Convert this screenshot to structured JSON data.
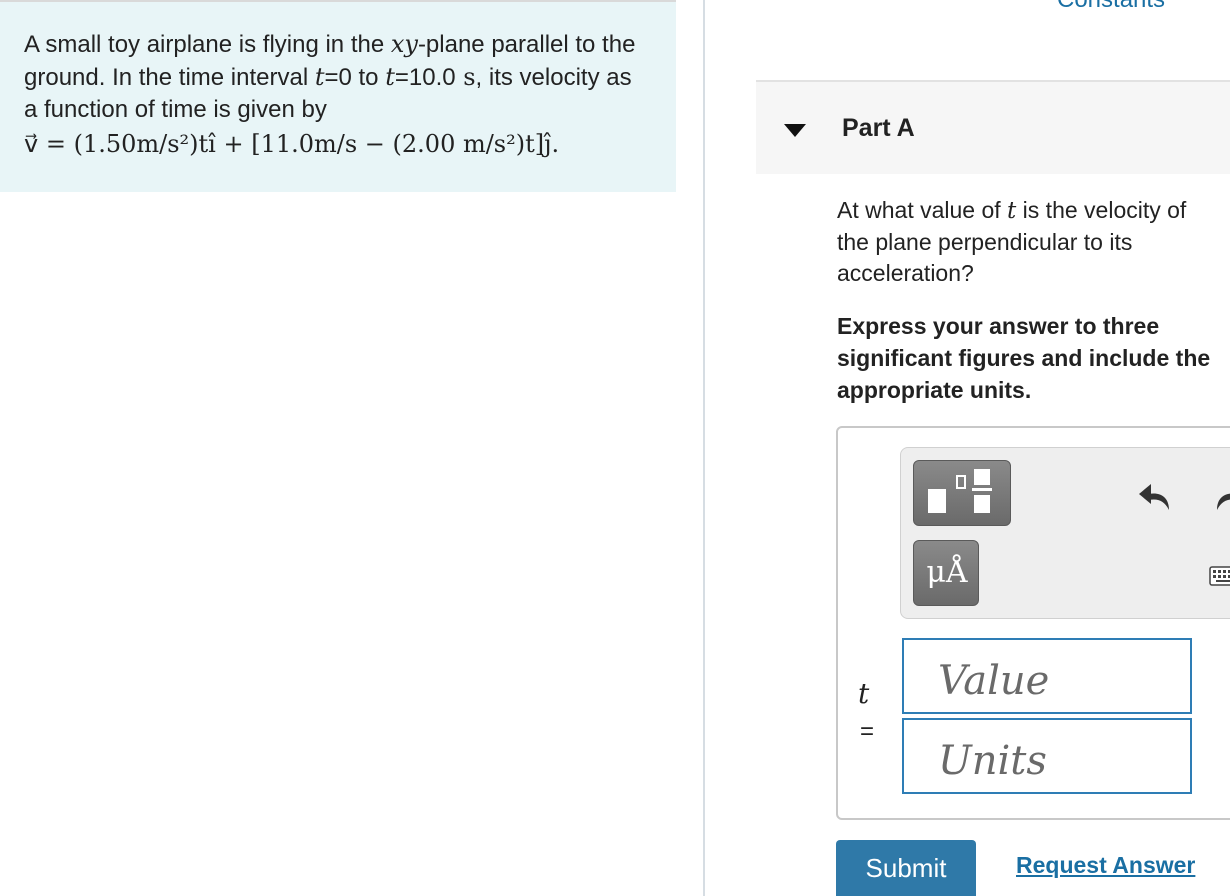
{
  "problem": {
    "text_1": "A small toy airplane is flying in the ",
    "var_xy": "xy",
    "text_2": "-plane parallel to the ground. In the time interval ",
    "var_t": "t",
    "text_3": "=0 to ",
    "text_4": "=10.0",
    "unit_s": " s",
    "text_5": ", its velocity as a function of time is given by",
    "equation": "v⃗ = (1.50m/s²)tî + [11.0m/s − (2.00 m/s²)t]ĵ."
  },
  "constants_link": "Constants",
  "part": {
    "title": "Part A",
    "question_1": "At what value of ",
    "question_var": "t",
    "question_2": " is the velocity of",
    "question_3": "the plane perpendicular to its",
    "question_4": "acceleration?",
    "instructions": "Express your answer to three significant figures and include the appropriate units."
  },
  "toolbar": {
    "units_button_label": "μÅ",
    "templates_icon": "templates-icon",
    "undo_icon": "undo-icon",
    "redo_icon": "redo-icon",
    "keyboard_icon": "keyboard-icon"
  },
  "answer": {
    "variable": "t",
    "equals": "=",
    "value_placeholder": "Value",
    "units_placeholder": "Units"
  },
  "buttons": {
    "submit": "Submit",
    "request_answer": "Request Answer"
  }
}
